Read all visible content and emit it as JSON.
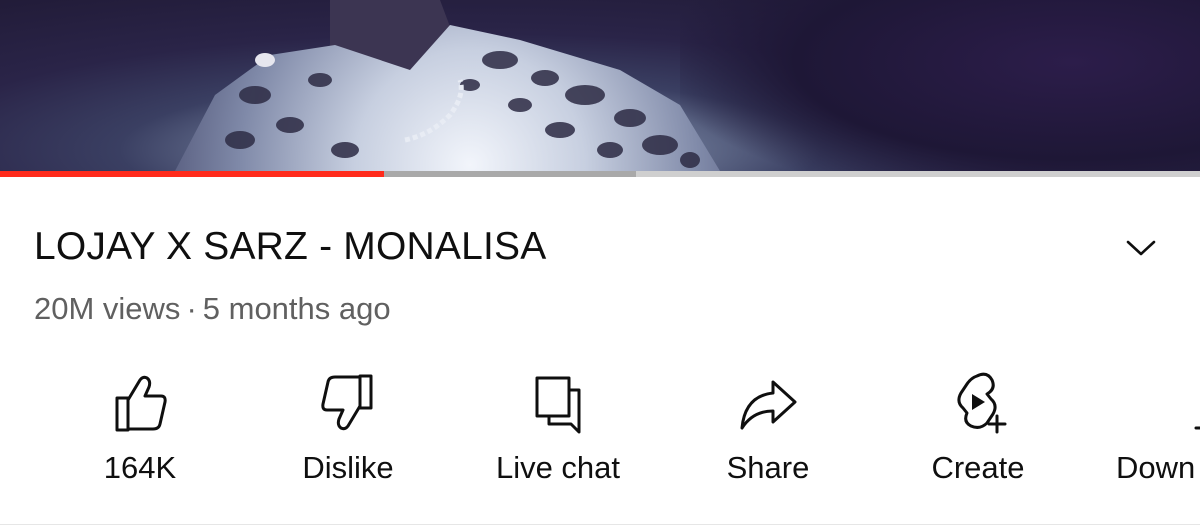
{
  "video": {
    "progress_fraction": 0.32,
    "buffer_fraction": 0.53
  },
  "colors": {
    "progress_red": "#ff2b1c",
    "text_primary": "#0f0f0f",
    "text_secondary": "#606060"
  },
  "title": "LOJAY X SARZ - MONALISA",
  "meta": {
    "views": "20M views",
    "separator": "·",
    "age": "5 months ago"
  },
  "actions": [
    {
      "icon": "thumbs-up-icon",
      "label": "164K"
    },
    {
      "icon": "thumbs-down-icon",
      "label": "Dislike"
    },
    {
      "icon": "live-chat-icon",
      "label": "Live chat"
    },
    {
      "icon": "share-icon",
      "label": "Share"
    },
    {
      "icon": "create-icon",
      "label": "Create"
    },
    {
      "icon": "download-icon",
      "label": "Down"
    }
  ]
}
